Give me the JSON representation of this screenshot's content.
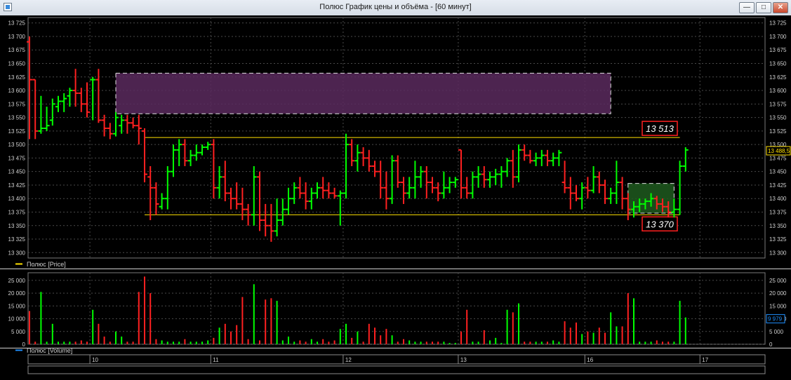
{
  "window": {
    "title": "Полюс График цены и объёма - [60 минут]",
    "buttons": {
      "minimize": "—",
      "maximize": "□",
      "close": "✕"
    }
  },
  "chart_data": [
    {
      "type": "candlestick",
      "series_name": "Полюс [Price]",
      "y_ticks": [
        "13 300",
        "13 325",
        "13 350",
        "13 375",
        "13 400",
        "13 425",
        "13 450",
        "13 475",
        "13 500",
        "13 525",
        "13 550",
        "13 575",
        "13 600",
        "13 625",
        "13 650",
        "13 675",
        "13 700",
        "13 725"
      ],
      "ylim": [
        13290,
        13735
      ],
      "last_price": "13 488,5",
      "levels": [
        {
          "label": "13 513",
          "value": 13513
        },
        {
          "label": "13 370",
          "value": 13370
        }
      ],
      "zones": [
        {
          "kind": "resistance",
          "from": 13557,
          "to": 13632,
          "start_bar": 15,
          "end_bar": 101,
          "color": "#5a2a5e"
        },
        {
          "kind": "target",
          "from": 13373,
          "to": 13428,
          "start_bar": 104,
          "end_bar": 112,
          "color": "#1e5a1e"
        }
      ],
      "colors": {
        "up": "#00ff00",
        "down": "#ff2020",
        "grid": "#4a4a4a",
        "level": "#ffe000"
      },
      "bars": [
        [
          13690,
          13700,
          13510,
          13620
        ],
        [
          13620,
          13620,
          13510,
          13525
        ],
        [
          13525,
          13590,
          13520,
          13530
        ],
        [
          13530,
          13570,
          13525,
          13535
        ],
        [
          13545,
          13585,
          13535,
          13575
        ],
        [
          13570,
          13590,
          13560,
          13580
        ],
        [
          13580,
          13595,
          13560,
          13585
        ],
        [
          13590,
          13605,
          13570,
          13600
        ],
        [
          13600,
          13640,
          13570,
          13595
        ],
        [
          13595,
          13605,
          13560,
          13575
        ],
        [
          13575,
          13615,
          13550,
          13560
        ],
        [
          13620,
          13625,
          13545,
          13620
        ],
        [
          13620,
          13640,
          13540,
          13545
        ],
        [
          13545,
          13555,
          13515,
          13530
        ],
        [
          13530,
          13540,
          13510,
          13520
        ],
        [
          13520,
          13560,
          13515,
          13550
        ],
        [
          13535,
          13555,
          13520,
          13545
        ],
        [
          13545,
          13555,
          13520,
          13540
        ],
        [
          13540,
          13550,
          13530,
          13535
        ],
        [
          13535,
          13555,
          13500,
          13530
        ],
        [
          13525,
          13530,
          13430,
          13445
        ],
        [
          13440,
          13460,
          13360,
          13420
        ],
        [
          13420,
          13430,
          13370,
          13390
        ],
        [
          13385,
          13410,
          13380,
          13400
        ],
        [
          13400,
          13460,
          13380,
          13450
        ],
        [
          13450,
          13500,
          13440,
          13490
        ],
        [
          13490,
          13510,
          13460,
          13500
        ],
        [
          13500,
          13510,
          13460,
          13470
        ],
        [
          13470,
          13490,
          13460,
          13480
        ],
        [
          13480,
          13500,
          13470,
          13485
        ],
        [
          13485,
          13500,
          13480,
          13495
        ],
        [
          13495,
          13505,
          13490,
          13500
        ],
        [
          13500,
          13510,
          13400,
          13420
        ],
        [
          13420,
          13460,
          13400,
          13440
        ],
        [
          13440,
          13470,
          13395,
          13410
        ],
        [
          13410,
          13420,
          13380,
          13400
        ],
        [
          13400,
          13430,
          13380,
          13390
        ],
        [
          13390,
          13420,
          13360,
          13380
        ],
        [
          13380,
          13390,
          13350,
          13370
        ],
        [
          13370,
          13460,
          13350,
          13440
        ],
        [
          13440,
          13450,
          13340,
          13360
        ],
        [
          13360,
          13390,
          13330,
          13350
        ],
        [
          13350,
          13390,
          13320,
          13340
        ],
        [
          13340,
          13400,
          13330,
          13360
        ],
        [
          13360,
          13400,
          13350,
          13380
        ],
        [
          13380,
          13420,
          13370,
          13400
        ],
        [
          13400,
          13430,
          13390,
          13420
        ],
        [
          13420,
          13440,
          13400,
          13410
        ],
        [
          13410,
          13430,
          13380,
          13395
        ],
        [
          13395,
          13420,
          13380,
          13410
        ],
        [
          13410,
          13430,
          13400,
          13420
        ],
        [
          13420,
          13440,
          13400,
          13415
        ],
        [
          13415,
          13430,
          13400,
          13410
        ],
        [
          13410,
          13420,
          13400,
          13405
        ],
        [
          13405,
          13415,
          13350,
          13410
        ],
        [
          13410,
          13520,
          13400,
          13500
        ],
        [
          13500,
          13510,
          13460,
          13470
        ],
        [
          13470,
          13500,
          13450,
          13485
        ],
        [
          13485,
          13495,
          13460,
          13475
        ],
        [
          13475,
          13490,
          13450,
          13460
        ],
        [
          13460,
          13470,
          13440,
          13450
        ],
        [
          13450,
          13470,
          13400,
          13420
        ],
        [
          13420,
          13450,
          13380,
          13400
        ],
        [
          13400,
          13480,
          13390,
          13470
        ],
        [
          13470,
          13480,
          13420,
          13430
        ],
        [
          13430,
          13440,
          13390,
          13410
        ],
        [
          13410,
          13440,
          13400,
          13420
        ],
        [
          13420,
          13470,
          13400,
          13440
        ],
        [
          13440,
          13460,
          13420,
          13450
        ],
        [
          13450,
          13460,
          13400,
          13430
        ],
        [
          13430,
          13440,
          13410,
          13420
        ],
        [
          13420,
          13430,
          13395,
          13410
        ],
        [
          13410,
          13450,
          13400,
          13420
        ],
        [
          13420,
          13440,
          13410,
          13430
        ],
        [
          13430,
          13440,
          13420,
          13435
        ],
        [
          13490,
          13490,
          13400,
          13420
        ],
        [
          13420,
          13440,
          13400,
          13410
        ],
        [
          13410,
          13450,
          13400,
          13440
        ],
        [
          13440,
          13460,
          13420,
          13445
        ],
        [
          13445,
          13460,
          13420,
          13435
        ],
        [
          13435,
          13450,
          13420,
          13440
        ],
        [
          13440,
          13455,
          13425,
          13445
        ],
        [
          13445,
          13460,
          13420,
          13450
        ],
        [
          13450,
          13475,
          13440,
          13470
        ],
        [
          13470,
          13490,
          13420,
          13440
        ],
        [
          13440,
          13500,
          13430,
          13490
        ],
        [
          13490,
          13500,
          13470,
          13480
        ],
        [
          13480,
          13490,
          13465,
          13470
        ],
        [
          13470,
          13485,
          13460,
          13475
        ],
        [
          13475,
          13490,
          13460,
          13480
        ],
        [
          13480,
          13490,
          13460,
          13470
        ],
        [
          13470,
          13485,
          13460,
          13475
        ],
        [
          13475,
          13490,
          13460,
          13485
        ],
        [
          13430,
          13470,
          13410,
          13420
        ],
        [
          13420,
          13440,
          13380,
          13410
        ],
        [
          13410,
          13425,
          13395,
          13400
        ],
        [
          13400,
          13430,
          13380,
          13420
        ],
        [
          13420,
          13440,
          13400,
          13415
        ],
        [
          13415,
          13460,
          13410,
          13440
        ],
        [
          13440,
          13450,
          13410,
          13425
        ],
        [
          13425,
          13435,
          13390,
          13400
        ],
        [
          13400,
          13420,
          13390,
          13410
        ],
        [
          13410,
          13470,
          13390,
          13430
        ],
        [
          13430,
          13440,
          13380,
          13400
        ],
        [
          13400,
          13410,
          13360,
          13380
        ],
        [
          13380,
          13395,
          13365,
          13385
        ],
        [
          13385,
          13400,
          13375,
          13390
        ],
        [
          13390,
          13400,
          13380,
          13395
        ],
        [
          13395,
          13410,
          13385,
          13400
        ],
        [
          13400,
          13405,
          13380,
          13390
        ],
        [
          13390,
          13400,
          13375,
          13385
        ],
        [
          13385,
          13395,
          13365,
          13375
        ],
        [
          13375,
          13400,
          13365,
          13380
        ],
        [
          13380,
          13470,
          13370,
          13460
        ],
        [
          13460,
          13495,
          13450,
          13490
        ]
      ]
    },
    {
      "type": "bar",
      "series_name": "Полюс [Volume]",
      "y_ticks": [
        "0",
        "5 000",
        "10 000",
        "15 000",
        "20 000",
        "25 000"
      ],
      "ylim": [
        0,
        28000
      ],
      "last_volume": "9 979",
      "values": [
        13000,
        1000,
        20500,
        1000,
        8000,
        1000,
        1000,
        1000,
        1000,
        1500,
        1000,
        13500,
        8000,
        3000,
        1000,
        5000,
        3000,
        1000,
        1000,
        20500,
        26500,
        20000,
        2000,
        1500,
        1000,
        1000,
        1000,
        2000,
        1000,
        1000,
        1000,
        1500,
        2500,
        6500,
        8000,
        5000,
        7500,
        18500,
        2000,
        23500,
        1500,
        17500,
        18000,
        17000,
        1500,
        3000,
        1000,
        1500,
        1000,
        2000,
        1000,
        2000,
        1000,
        1500,
        6000,
        8000,
        2500,
        5000,
        1000,
        8000,
        6500,
        3500,
        6000,
        3500,
        1000,
        2000,
        1500,
        1000,
        1000,
        1000,
        1000,
        1000,
        1000,
        500,
        500,
        5000,
        13500,
        1000,
        1000,
        5500,
        1500,
        2500,
        500,
        13500,
        12500,
        16000,
        1000,
        1000,
        1000,
        1000,
        1000,
        1500,
        1000,
        9000,
        6500,
        8500,
        4000,
        5000,
        4500,
        6500,
        4500,
        12500,
        7000,
        7000,
        20000,
        18000,
        1000,
        1000,
        1000,
        1500,
        1000,
        1000,
        1000,
        17000,
        10500
      ]
    }
  ],
  "x_axis": {
    "labels": [
      {
        "label": "10",
        "bar": 11
      },
      {
        "label": "11",
        "bar": 32
      },
      {
        "label": "12",
        "bar": 55
      },
      {
        "label": "13",
        "bar": 75
      },
      {
        "label": "16",
        "bar": 97
      },
      {
        "label": "17",
        "bar": 117
      }
    ]
  }
}
